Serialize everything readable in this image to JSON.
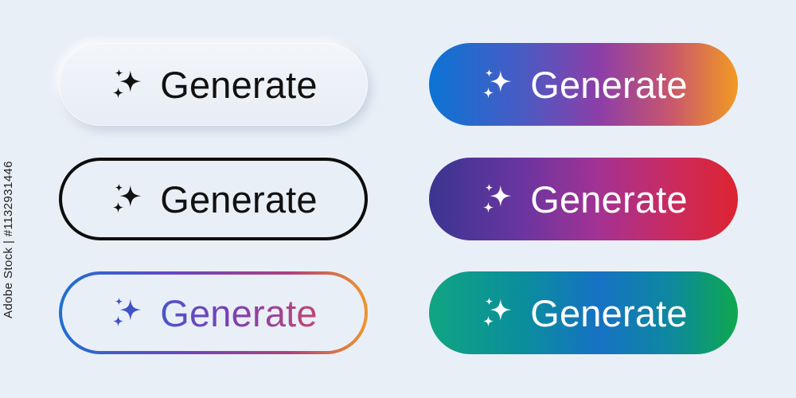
{
  "watermark": {
    "text": "Adobe Stock | #1132931446"
  },
  "buttons": {
    "neumorphic": {
      "label": "Generate",
      "icon": "sparkles-icon"
    },
    "outline_black": {
      "label": "Generate",
      "icon": "sparkles-icon"
    },
    "outline_gradient": {
      "label": "Generate",
      "icon": "sparkles-icon"
    },
    "gradient_blue_orange": {
      "label": "Generate",
      "icon": "sparkles-icon"
    },
    "gradient_purple_red": {
      "label": "Generate",
      "icon": "sparkles-icon"
    },
    "gradient_teal_green": {
      "label": "Generate",
      "icon": "sparkles-icon"
    }
  },
  "colors": {
    "background": "#e9eff7",
    "text_dark": "#111111",
    "text_light": "#ffffff",
    "blue": "#0a74d4",
    "purple": "#8c3ea8",
    "orange": "#f29a22",
    "red": "#dd2430",
    "teal": "#11a582",
    "green": "#0ea84e"
  }
}
